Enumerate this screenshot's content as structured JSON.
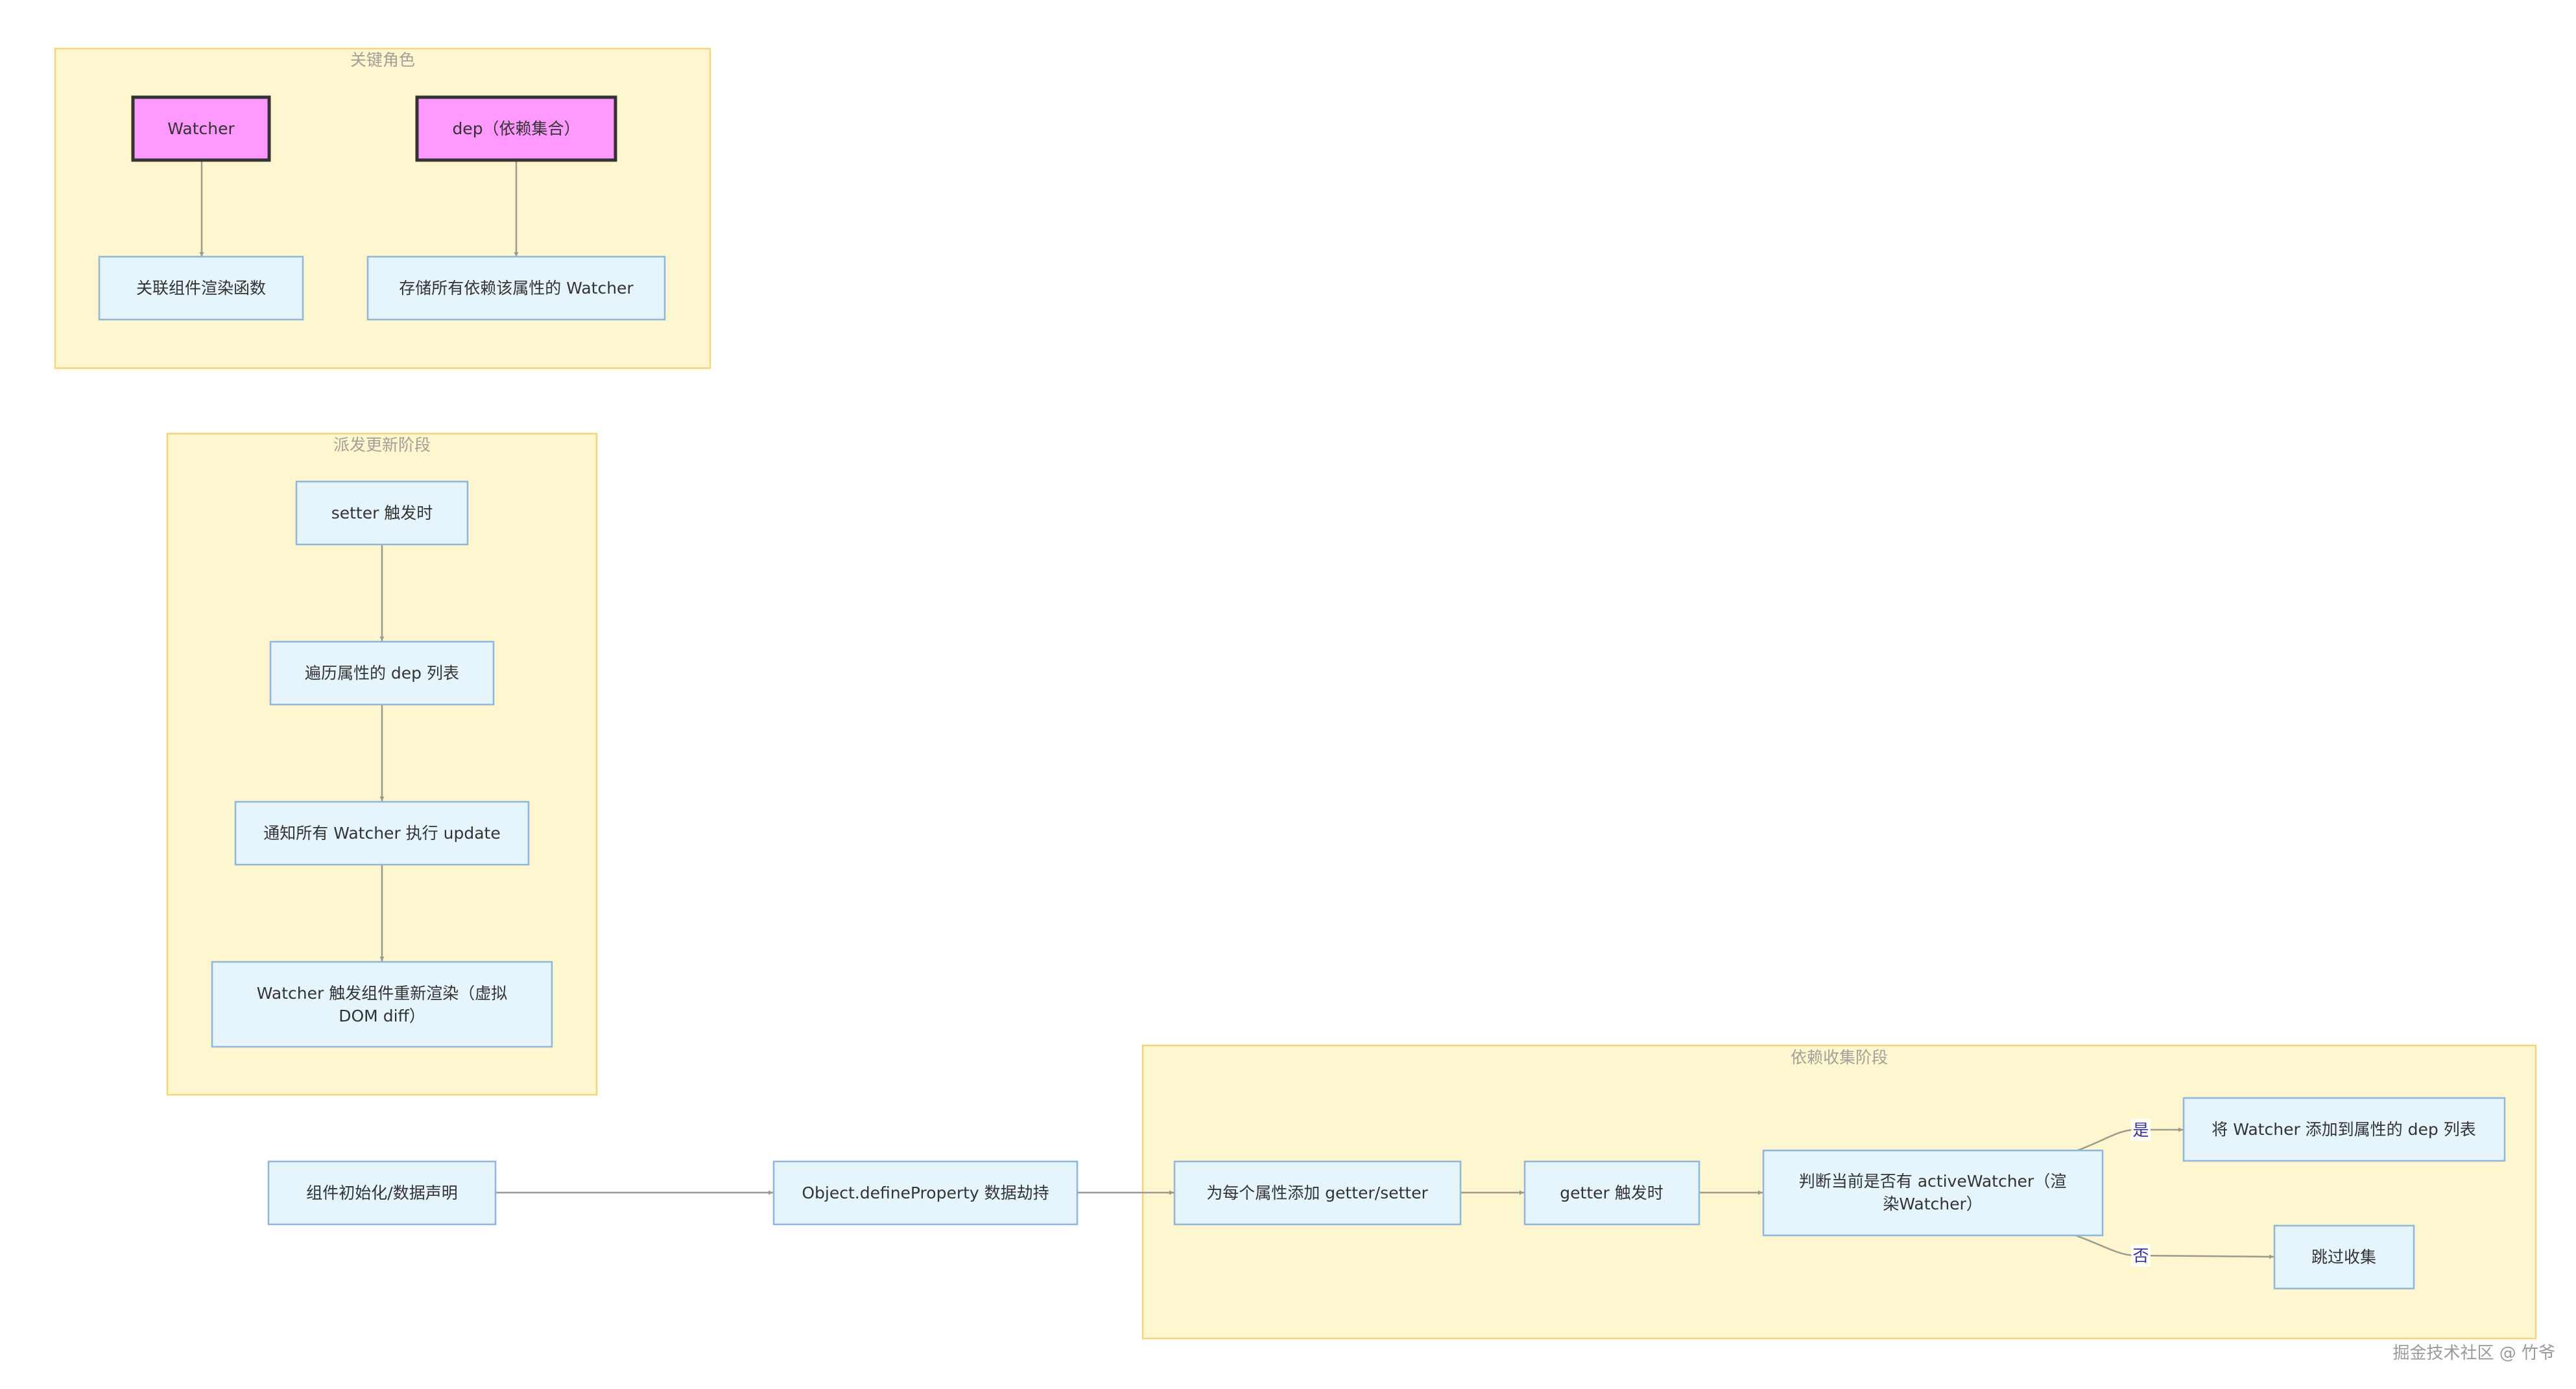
{
  "clusters": {
    "roles": {
      "title": "关键角色"
    },
    "dispatch": {
      "title": "派发更新阶段"
    },
    "collect": {
      "title": "依赖收集阶段"
    }
  },
  "nodes": {
    "watcher": "Watcher",
    "dep": "dep（依赖集合）",
    "render_fn": "关联组件渲染函数",
    "store_watchers": "存储所有依赖该属性的 Watcher",
    "setter_trigger": "setter 触发时",
    "traverse_dep": "遍历属性的 dep 列表",
    "notify_update": "通知所有 Watcher 执行 update",
    "rerender_line1": "Watcher 触发组件重新渲染（虚拟",
    "rerender_line2": "DOM diff）",
    "init": "组件初始化/数据声明",
    "define_property": "Object.defineProperty 数据劫持",
    "add_getter_setter": "为每个属性添加 getter/setter",
    "getter_trigger": "getter 触发时",
    "judge_line1": "判断当前是否有 activeWatcher（渲",
    "judge_line2": "染Watcher）",
    "add_watcher": "将 Watcher 添加到属性的 dep 列表",
    "skip": "跳过收集"
  },
  "edge_labels": {
    "yes": "是",
    "no": "否"
  },
  "watermark": "掘金技术社区 @ 竹爷",
  "colors": {
    "cluster_fill": "#fdf6cf",
    "cluster_stroke": "#f3d57e",
    "node_fill": "#e6f5fc",
    "node_stroke": "#8fb6dc",
    "role_fill": "#ff99ff",
    "edge": "#9b9b8e"
  }
}
